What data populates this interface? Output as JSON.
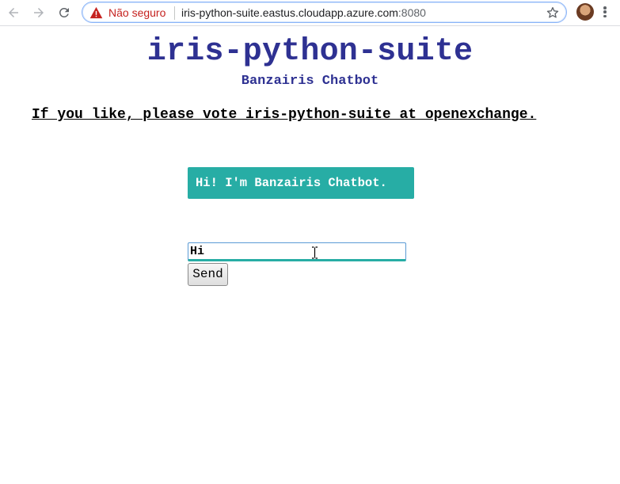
{
  "browser": {
    "security_label": "Não seguro",
    "url_host": "iris-python-suite.eastus.cloudapp.azure.com",
    "url_port": ":8080",
    "icons": [
      "back-arrow-icon",
      "forward-arrow-icon",
      "reload-icon",
      "warning-icon",
      "star-icon",
      "avatar",
      "kebab-menu-icon"
    ]
  },
  "page": {
    "title": "iris-python-suite",
    "subtitle": "Banzairis Chatbot",
    "vote_link": "If you like, please vote iris-python-suite at openexchange.",
    "bot_message": "Hi! I'm Banzairis Chatbot.",
    "input_value": "Hi",
    "send_label": "Send"
  },
  "colors": {
    "title": "#2e3192",
    "bot_bubble": "#27ada5",
    "insecure": "#c5221f"
  }
}
